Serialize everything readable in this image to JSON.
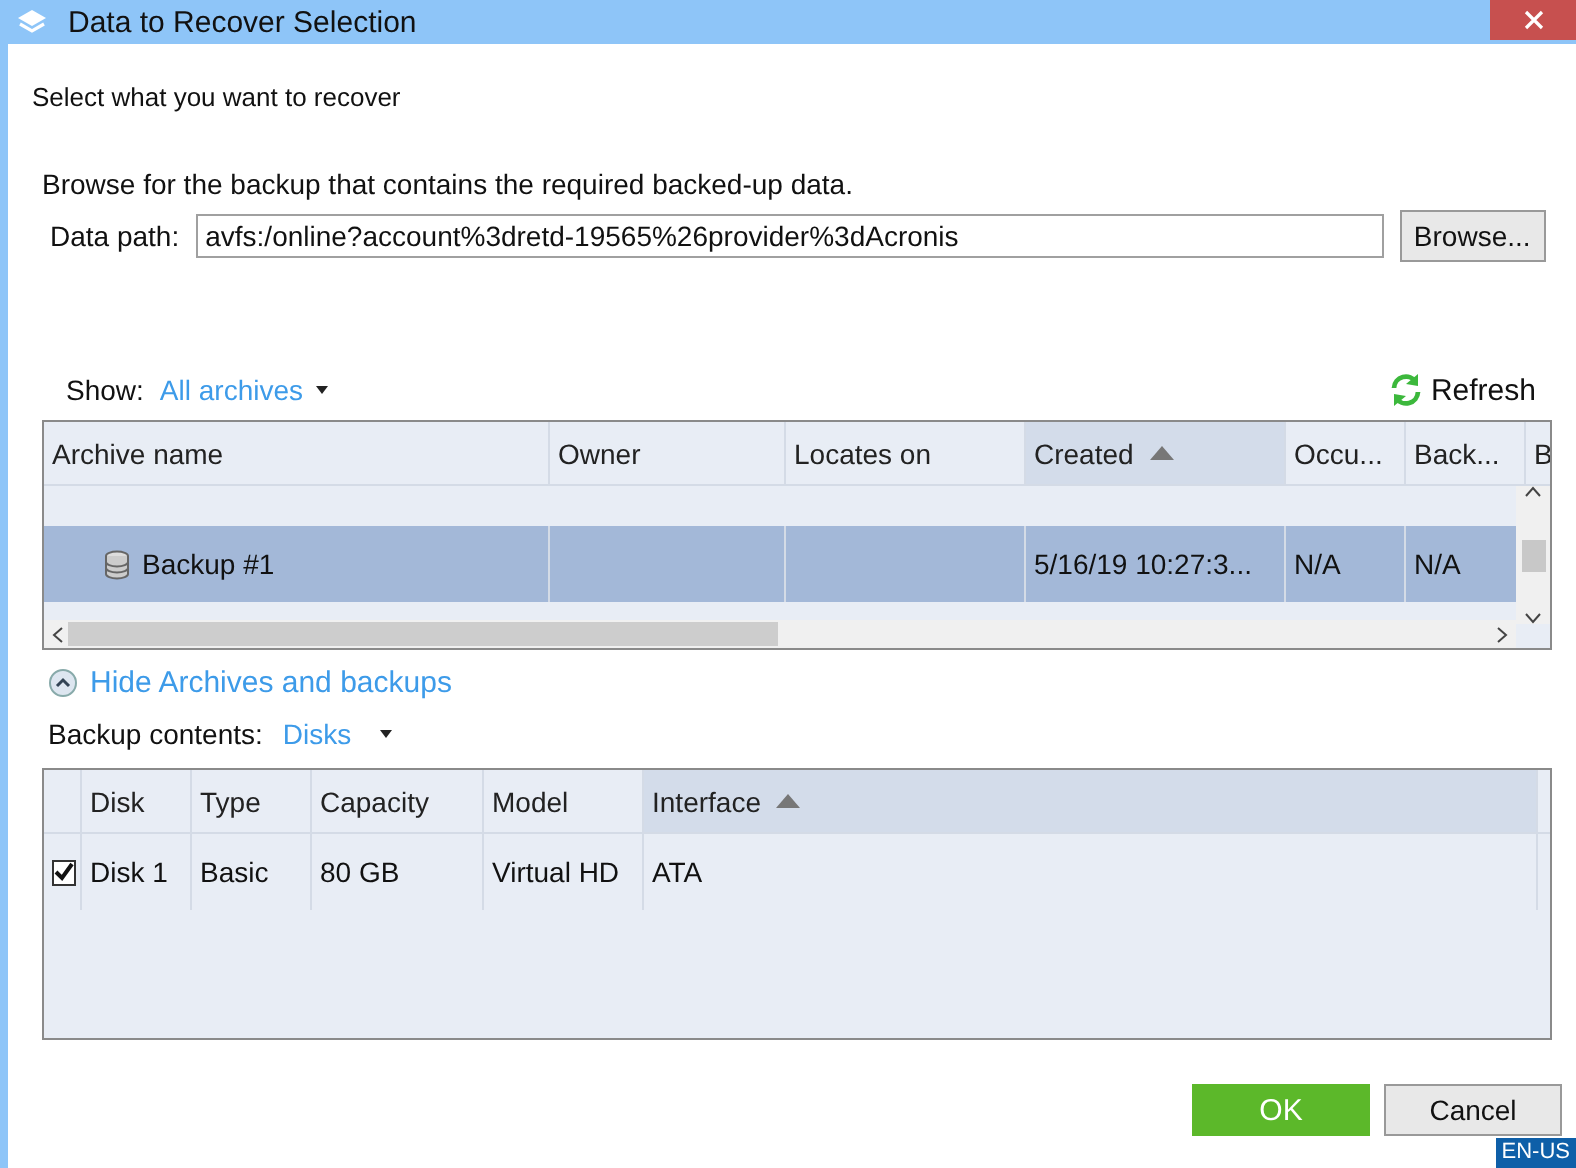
{
  "window": {
    "title": "Data to Recover Selection"
  },
  "heading": "Select what you want to recover",
  "instruction": "Browse for the backup that contains the required backed-up data.",
  "data_path": {
    "label": "Data path:",
    "value": "avfs:/online?account%3dretd-19565%26provider%3dAcronis",
    "button": "Browse..."
  },
  "show": {
    "label": "Show:",
    "value": "All archives"
  },
  "refresh": "Refresh",
  "archives": {
    "columns": [
      {
        "label": "Archive name",
        "sorted": false
      },
      {
        "label": "Owner",
        "sorted": false
      },
      {
        "label": "Locates on",
        "sorted": false
      },
      {
        "label": "Created",
        "sorted": true
      },
      {
        "label": "Occu...",
        "sorted": false
      },
      {
        "label": "Back...",
        "sorted": false
      },
      {
        "label": "B",
        "sorted": false
      }
    ],
    "rows": [
      {
        "selected": true,
        "archive_name": "Backup #1",
        "created": "5/16/19 10:27:3...",
        "column_5": "N/A",
        "column_6": "N/A"
      }
    ]
  },
  "toggle": "Hide Archives and backups",
  "contents": {
    "label": "Backup contents:",
    "value": "Disks"
  },
  "disks": {
    "columns": [
      {
        "label": "Disk",
        "sorted": false
      },
      {
        "label": "Type",
        "sorted": false
      },
      {
        "label": "Capacity",
        "sorted": false
      },
      {
        "label": "Model",
        "sorted": false
      },
      {
        "label": "Interface",
        "sorted": true
      }
    ],
    "rows": [
      {
        "checked": true,
        "disk": "Disk 1",
        "type": "Basic",
        "capacity": "80 GB",
        "model": "Virtual HD",
        "interface": "ATA"
      }
    ]
  },
  "buttons": {
    "ok": "OK",
    "cancel": "Cancel"
  },
  "language": "EN-US"
}
